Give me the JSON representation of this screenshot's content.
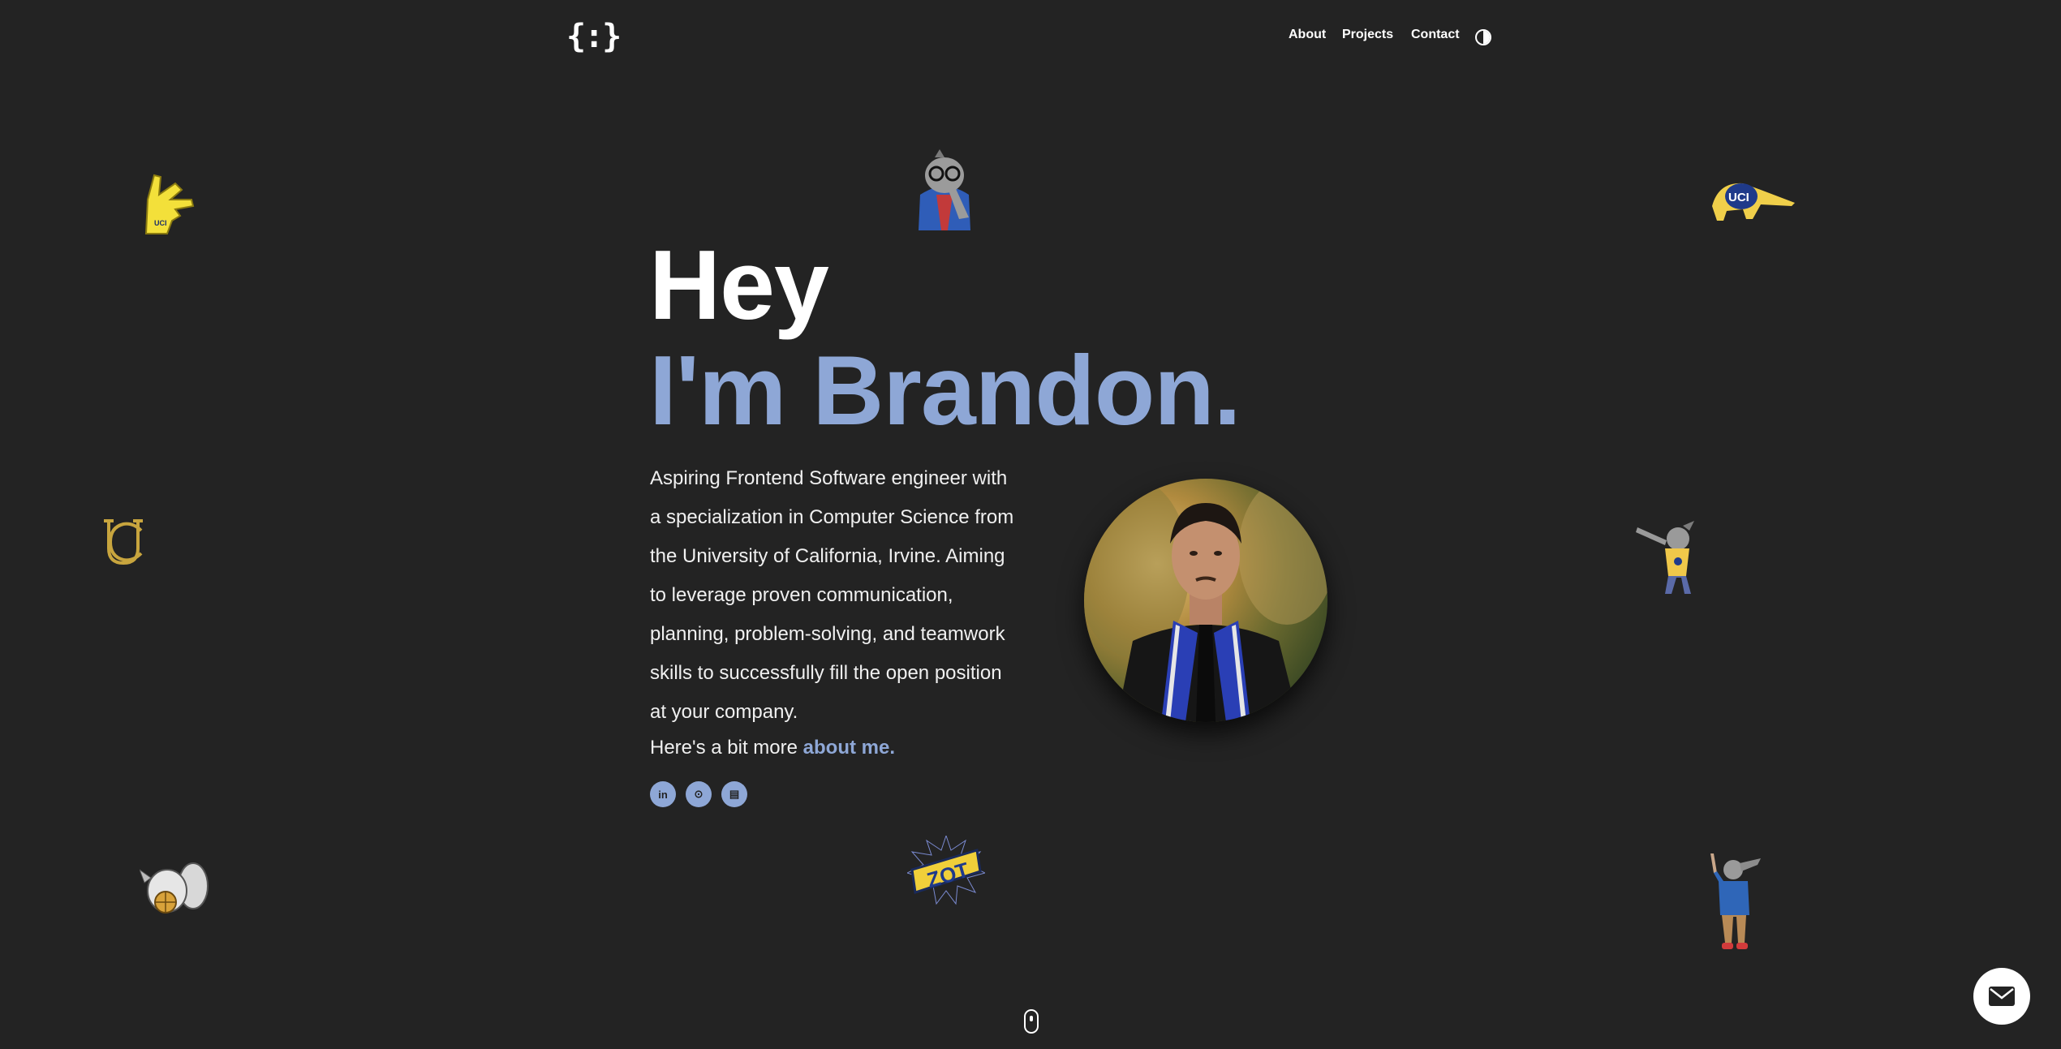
{
  "header": {
    "logo": "{:}",
    "nav": [
      {
        "label": "About"
      },
      {
        "label": "Projects"
      },
      {
        "label": "Contact"
      }
    ],
    "theme_toggle_icon": "half-circle-contrast-icon"
  },
  "hero": {
    "greeting": "Hey",
    "name_line": "I'm Brandon.",
    "bio_lines": [
      "Aspiring Frontend Software engineer with",
      "a specialization in Computer Science from",
      "the University of California, Irvine. Aiming",
      "to leverage proven communication,",
      "planning, problem-solving, and teamwork",
      "skills to successfully fill the open position",
      "at your company."
    ],
    "more_prefix": "Here's a bit more",
    "more_link": "about me.",
    "socials": [
      {
        "icon": "linkedin-icon",
        "glyph": "in"
      },
      {
        "icon": "github-icon",
        "glyph": "⊙"
      },
      {
        "icon": "resume-document-icon",
        "glyph": "▤"
      }
    ]
  },
  "stickers": [
    "anteater-hand-sign-sticker",
    "nerd-anteater-sticker",
    "uci-anteater-sticker",
    "uc-monogram-sticker",
    "dabbing-anteater-sticker",
    "anteater-with-basketball-sticker",
    "zot-sticker",
    "standing-anteater-sticker"
  ],
  "zot_text": "ZOT",
  "uci_text": "UCI",
  "colors": {
    "background": "#232323",
    "accent": "#8ea7d6",
    "text": "#ffffff"
  }
}
